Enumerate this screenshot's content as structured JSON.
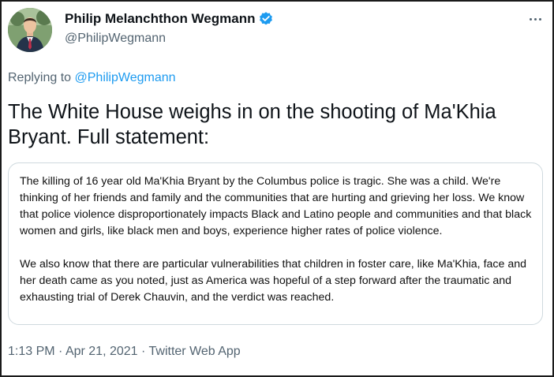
{
  "author": {
    "display_name": "Philip Melanchthon Wegmann",
    "handle": "@PhilipWegmann",
    "verified": true,
    "avatar_icon": "profile-photo"
  },
  "reply": {
    "prefix": "Replying to ",
    "target": "@PhilipWegmann"
  },
  "tweet": {
    "text": "The White House weighs in on the shooting of Ma'Khia Bryant. Full statement:"
  },
  "statement": {
    "paragraphs": [
      "The killing of 16 year old Ma'Khia Bryant by the Columbus police is tragic. She was a child. We're thinking of her friends and family and the communities that are hurting and grieving her loss. We know that police violence disproportionately impacts Black and Latino people and communities and that black women and girls, like black men and boys, experience higher rates of police violence.",
      "We also know that there are particular vulnerabilities that children in foster care, like Ma'Khia, face and her death came as you noted, just as America was hopeful of a step forward after the traumatic and exhausting trial of Derek Chauvin, and the verdict was reached."
    ]
  },
  "meta": {
    "time": "1:13 PM",
    "separator": " · ",
    "date": "Apr 21, 2021",
    "source": "Twitter Web App"
  },
  "colors": {
    "accent": "#1d9bf0",
    "secondary_text": "#536471",
    "border": "#cfd9de"
  }
}
